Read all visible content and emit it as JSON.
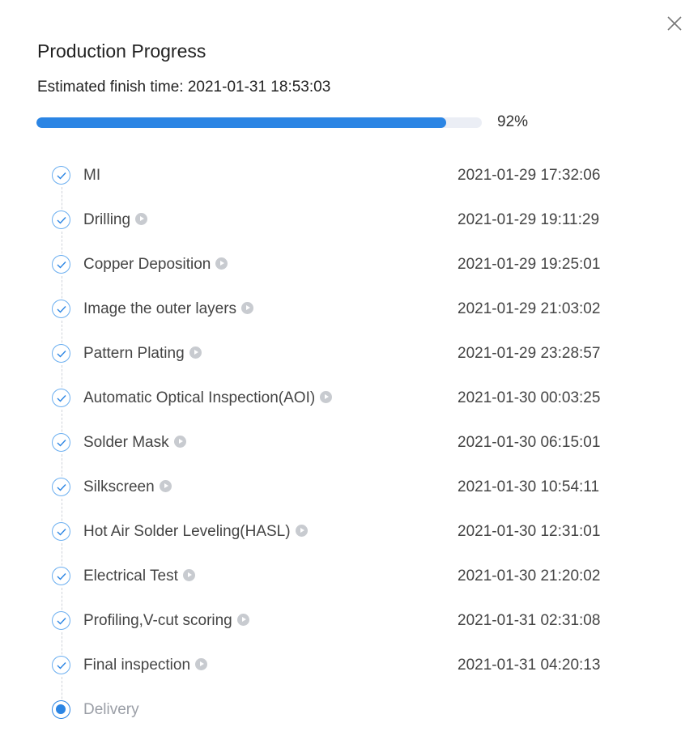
{
  "dialog": {
    "title": "Production Progress",
    "close_icon": "close-icon",
    "estimate_label": "Estimated finish time: ",
    "estimate_value": "2021-01-31 18:53:03"
  },
  "progress": {
    "percent": 92,
    "label": "92%",
    "color": "#2b85e4",
    "track_color": "#ebeef5"
  },
  "steps": [
    {
      "name": "MI",
      "time": "2021-01-29 17:32:06",
      "status": "done",
      "has_play": false
    },
    {
      "name": "Drilling",
      "time": "2021-01-29 19:11:29",
      "status": "done",
      "has_play": true
    },
    {
      "name": "Copper Deposition",
      "time": "2021-01-29 19:25:01",
      "status": "done",
      "has_play": true
    },
    {
      "name": "Image the outer layers",
      "time": "2021-01-29 21:03:02",
      "status": "done",
      "has_play": true
    },
    {
      "name": "Pattern Plating",
      "time": "2021-01-29 23:28:57",
      "status": "done",
      "has_play": true
    },
    {
      "name": "Automatic Optical Inspection(AOI)",
      "time": "2021-01-30 00:03:25",
      "status": "done",
      "has_play": true
    },
    {
      "name": "Solder Mask",
      "time": "2021-01-30 06:15:01",
      "status": "done",
      "has_play": true
    },
    {
      "name": "Silkscreen",
      "time": "2021-01-30 10:54:11",
      "status": "done",
      "has_play": true
    },
    {
      "name": "Hot Air Solder Leveling(HASL)",
      "time": "2021-01-30 12:31:01",
      "status": "done",
      "has_play": true
    },
    {
      "name": "Electrical Test",
      "time": "2021-01-30 21:20:02",
      "status": "done",
      "has_play": true
    },
    {
      "name": "Profiling,V-cut scoring",
      "time": "2021-01-31 02:31:08",
      "status": "done",
      "has_play": true
    },
    {
      "name": "Final inspection",
      "time": "2021-01-31 04:20:13",
      "status": "done",
      "has_play": true
    },
    {
      "name": "Delivery",
      "time": "",
      "status": "current",
      "has_play": false
    }
  ],
  "icons": {
    "done": "check-circle-icon",
    "current": "current-step-dot-icon",
    "play": "play-circle-icon"
  }
}
